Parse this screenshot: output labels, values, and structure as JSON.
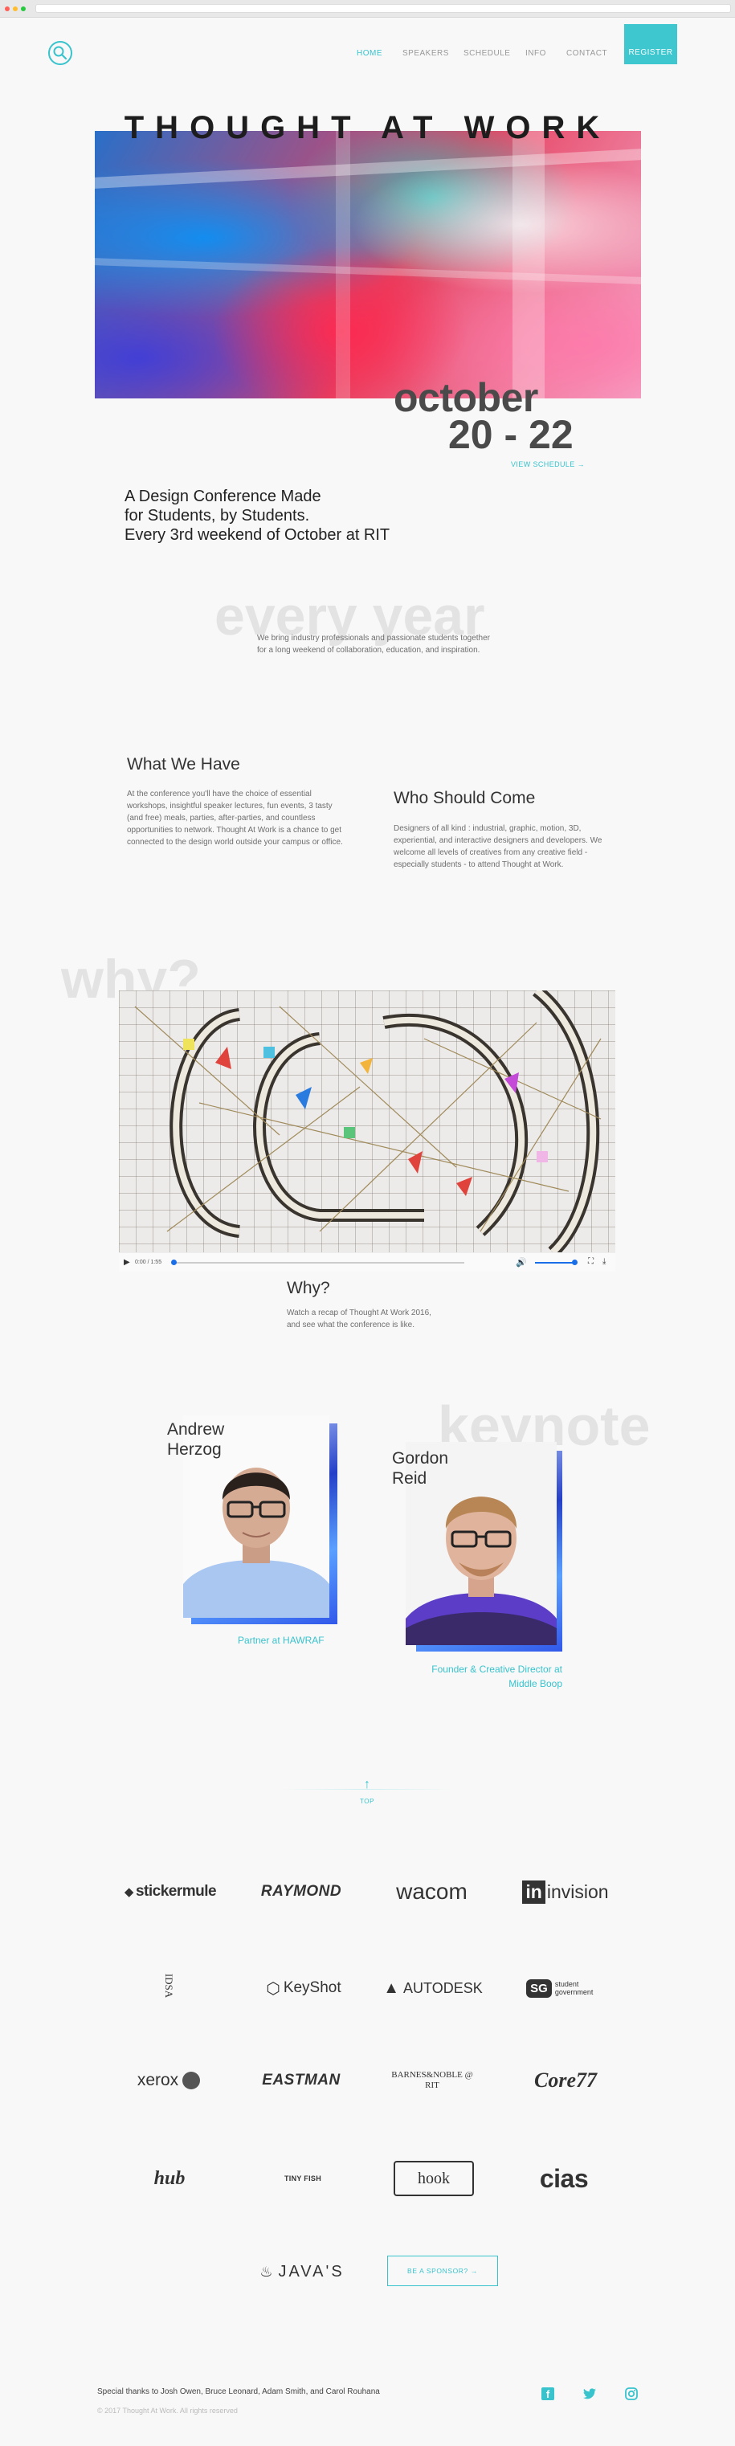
{
  "colors": {
    "accent": "#38c3cd",
    "watermark": "#e3e3e3",
    "text": "#333333"
  },
  "nav": {
    "logo_icon": "magnifier-logo-icon",
    "links": [
      "HOME",
      "SPEAKERS",
      "SCHEDULE",
      "INFO",
      "CONTACT"
    ],
    "active": "HOME",
    "register": "REGISTER"
  },
  "hero": {
    "title": "THOUGHT AT WORK",
    "month": "october",
    "days": "20 - 22",
    "view_schedule": "VIEW SCHEDULE →"
  },
  "tagline": {
    "line1": "A Design Conference Made",
    "line2": "for Students, by Students.",
    "line3": "Every 3rd weekend of October at RIT"
  },
  "every_year": {
    "watermark": "every year",
    "body": "We bring industry professionals and passionate students together for a long weekend of collaboration, education, and inspiration."
  },
  "what_we_have": {
    "title": "What We Have",
    "body": "At the conference you'll have the choice of essential workshops, insightful speaker lectures, fun events, 3 tasty (and free) meals, parties, after-parties, and countless opportunities to network. Thought At Work is a chance to get connected to the design world outside your campus or office."
  },
  "who_should_come": {
    "title": "Who Should Come",
    "body": "Designers of all kind : industrial, graphic, motion, 3D, experiential, and interactive designers and developers. We welcome all levels of creatives from any creative field - especially students - to attend Thought at Work."
  },
  "why": {
    "watermark": "why?",
    "video_time": "0:00 / 1:55",
    "title": "Why?",
    "body": "Watch a recap of Thought At Work 2016, and see what the conference is like."
  },
  "keynote": {
    "watermark": "keynote",
    "speakers": [
      {
        "first": "Andrew",
        "last": "Herzog",
        "role": "Partner at HAWRAF"
      },
      {
        "first": "Gordon",
        "last": "Reid",
        "role_line1": "Founder & Creative Director at",
        "role_line2": "Middle Boop"
      }
    ]
  },
  "top": {
    "arrow": "↑",
    "label": "TOP"
  },
  "sponsors": [
    "stickermule",
    "RAYMOND",
    "wacom",
    "invision",
    "IDSA",
    "KeyShot",
    "AUTODESK",
    "student government",
    "xerox",
    "EASTMAN",
    "BARNES&NOBLE @ RIT",
    "Core77",
    "hub",
    "TINY FISH",
    "hook",
    "cias",
    "JAVA'S"
  ],
  "sponsor_cta": "BE A SPONSOR? →",
  "footer": {
    "thanks": "Special thanks to Josh Owen, Bruce Leonard, Adam Smith, and Carol Rouhana",
    "copyright": "© 2017 Thought At Work. All rights reserved",
    "social": [
      "facebook-icon",
      "twitter-icon",
      "instagram-icon"
    ]
  }
}
